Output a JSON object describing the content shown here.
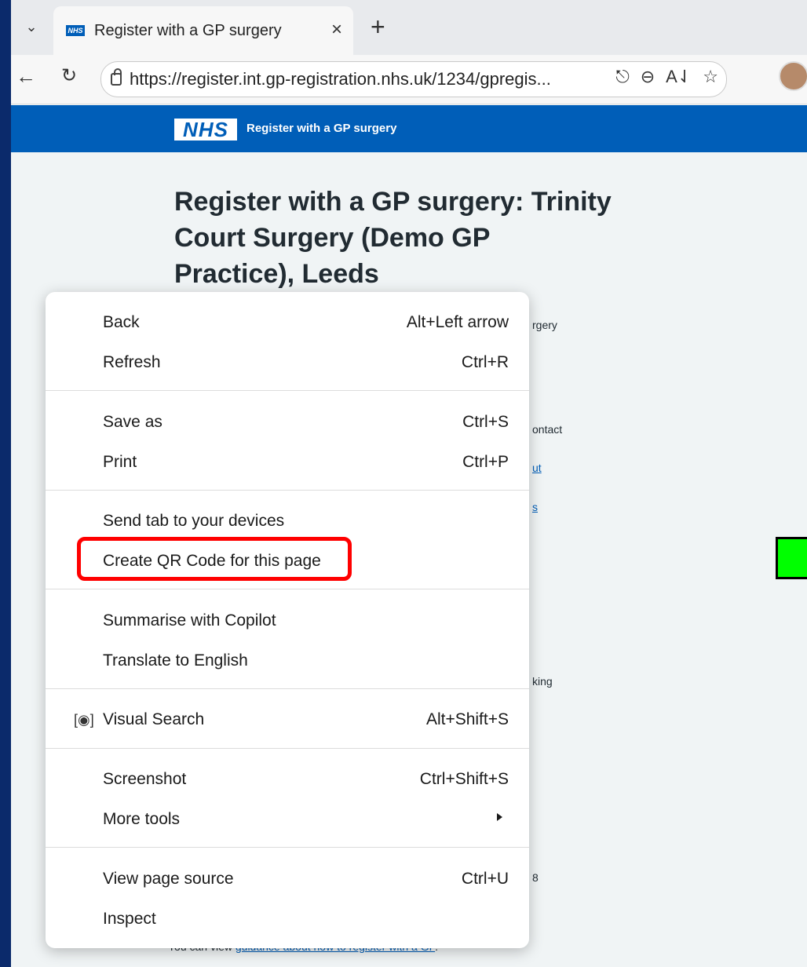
{
  "browser": {
    "tab": {
      "title": "Register with a GP surgery",
      "favicon": "NHS"
    },
    "address": {
      "url": "https://register.int.gp-registration.nhs.uk/1234/gpregis..."
    }
  },
  "page": {
    "header": {
      "logo": "NHS",
      "service": "Register with a GP surgery"
    },
    "title": "Register with a GP surgery: Trinity Court Surgery (Demo GP Practice), Leeds",
    "fragments": {
      "f1": "rgery",
      "f2": "ontact",
      "f3": "ut",
      "f4": "s",
      "f5": "king",
      "f6": "8"
    },
    "guidance_prefix": "You can view ",
    "guidance_link": "guidance about how to register with a GP",
    "guidance_suffix": "."
  },
  "context_menu": {
    "items": [
      {
        "label": "Back",
        "shortcut": "Alt+Left arrow"
      },
      {
        "label": "Refresh",
        "shortcut": "Ctrl+R"
      },
      {
        "label": "Save as",
        "shortcut": "Ctrl+S"
      },
      {
        "label": "Print",
        "shortcut": "Ctrl+P"
      },
      {
        "label": "Send tab to your devices",
        "shortcut": ""
      },
      {
        "label": "Create QR Code for this page",
        "shortcut": ""
      },
      {
        "label": "Summarise with Copilot",
        "shortcut": ""
      },
      {
        "label": "Translate to English",
        "shortcut": ""
      },
      {
        "label": "Visual Search",
        "shortcut": "Alt+Shift+S",
        "icon": "visual-search-icon"
      },
      {
        "label": "Screenshot",
        "shortcut": "Ctrl+Shift+S"
      },
      {
        "label": "More tools",
        "shortcut": "",
        "submenu": true
      },
      {
        "label": "View page source",
        "shortcut": "Ctrl+U"
      },
      {
        "label": "Inspect",
        "shortcut": ""
      }
    ],
    "highlighted_item": "Create QR Code for this page"
  },
  "colors": {
    "nhs_blue": "#005eb8",
    "highlight": "#ff0000",
    "marker": "#00ff00",
    "desktop": "#0b2a6b"
  }
}
